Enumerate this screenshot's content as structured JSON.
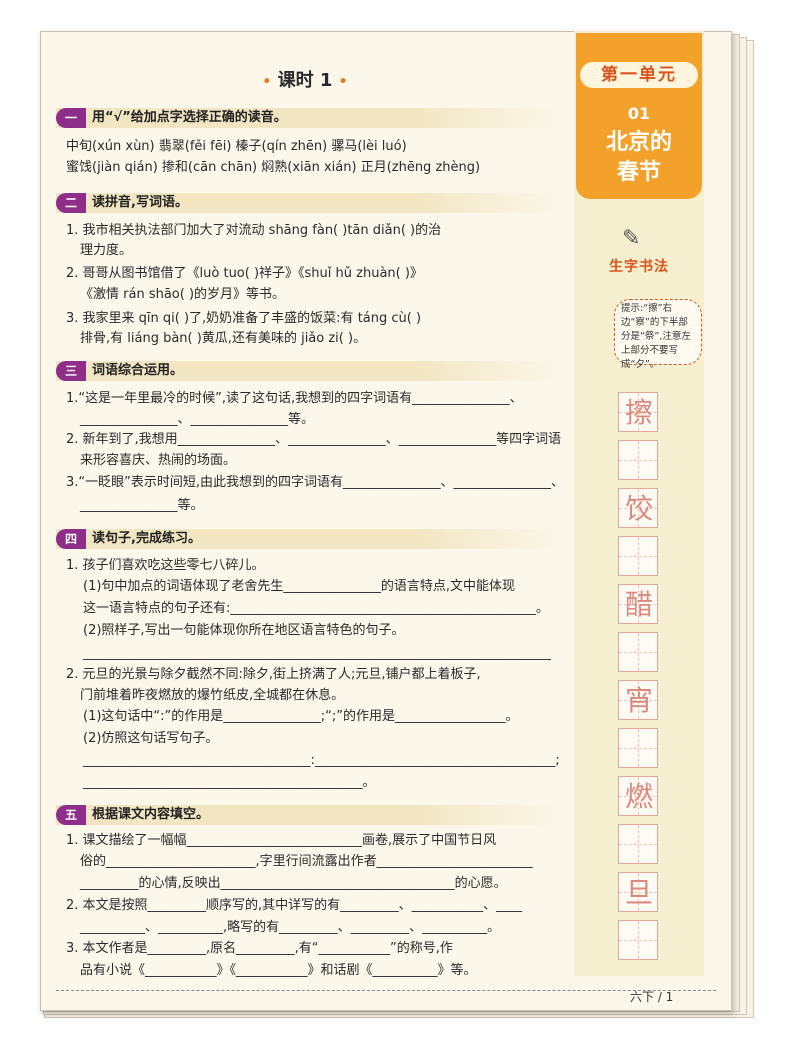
{
  "lesson_title": "课时 1",
  "lesson_dot": "•",
  "unit": {
    "label": "第一单元",
    "number": "01",
    "title_line1": "北京的",
    "title_line2": "春节"
  },
  "calligraphy": {
    "title": "生字书法",
    "tip": "提示:“擦”右边“察”的下半部分是“祭”,注意左上部分不要写成“夕”。",
    "chars": [
      "擦",
      "饺",
      "醋",
      "宵",
      "燃",
      "旦"
    ]
  },
  "sections": [
    {
      "tag": "一",
      "title": "用“√”给加点字选择正确的读音。",
      "lines": [
        "中旬(xún  xùn)      翡翠(fěi  fēi)      榛子(qín  zhēn)      骡马(lèi  luó)",
        "蜜饯(jiàn  qián)    掺和(cān  chān)  焖熟(xiān  xián)      正月(zhēng  zhèng)"
      ]
    },
    {
      "tag": "二",
      "title": "读拼音,写词语。",
      "lines": [
        "1. 我市相关执法部门加大了对流动 shāng fàn(               )tān diǎn(               )的治",
        "理力度。",
        "2. 哥哥从图书馆借了《luò tuo(               )祥子》《shuǐ hǔ zhuàn(               )》",
        "《激情 rán shāo(               )的岁月》等书。",
        "3. 我家里来 qīn qi(               )了,奶奶准备了丰盛的饭菜:有 táng cù(               )",
        "排骨,有 liáng bàn(               )黄瓜,还有美味的 jiǎo zi(               )。"
      ]
    },
    {
      "tag": "三",
      "title": "词语综合运用。",
      "lines": [
        "1.“这是一年里最冷的时候”,读了这句话,我想到的四字词语有_______________、",
        "_______________、_______________等。",
        "2. 新年到了,我想用_______________、_______________、_______________等四字词语",
        "来形容喜庆、热闹的场面。",
        "3.“一眨眼”表示时间短,由此我想到的四字词语有_______________、_______________、",
        "_______________等。"
      ]
    },
    {
      "tag": "四",
      "title": "读句子,完成练习。",
      "lines": [
        "1. 孩子们喜欢吃这些零七八碎儿。",
        "(1)句中加点的词语体现了老舍先生_______________的语言特点,文中能体现",
        "这一语言特点的句子还有:_______________________________________________。",
        "(2)照样子,写出一句能体现你所在地区语言特色的句子。",
        "________________________________________________________________________",
        "2. 元旦的光景与除夕截然不同:除夕,街上挤满了人;元旦,铺户都上着板子,",
        "门前堆着昨夜燃放的爆竹纸皮,全城都在休息。",
        "(1)这句话中“:”的作用是_______________;“;”的作用是_________________。",
        "(2)仿照这句话写句子。",
        "___________________________________:_____________________________________;",
        "___________________________________________。"
      ]
    },
    {
      "tag": "五",
      "title": "根据课文内容填空。",
      "lines": [
        "1. 课文描绘了一幅幅___________________________画卷,展示了中国节日风",
        "俗的_______________________,字里行间流露出作者________________________",
        "_________的心情,反映出____________________________________的心愿。",
        "2. 本文是按照_________顺序写的,其中详写的有_________、___________、____",
        "__________、__________,略写的有_________、_________、__________。",
        "3. 本文作者是_________,原名_________,有“___________”的称号,作",
        "品有小说《___________》《___________》和话剧《__________》等。"
      ]
    }
  ],
  "page_number": "六下 / 1"
}
